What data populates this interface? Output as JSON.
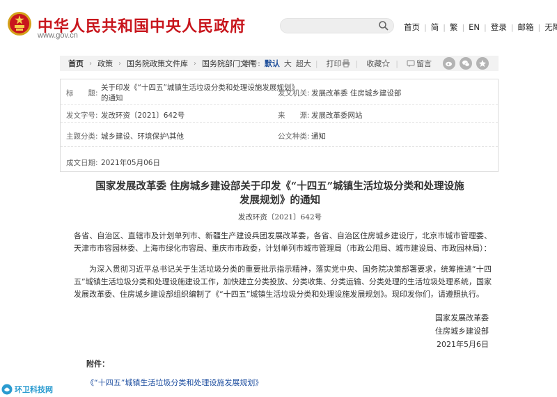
{
  "header": {
    "site_title": "中华人民共和国中央人民政府",
    "site_domain": "www.gov.cn",
    "search_placeholder": "",
    "links": [
      "首页",
      "简",
      "繁",
      "EN",
      "登录",
      "邮箱",
      "无障碍"
    ]
  },
  "breadcrumb": {
    "items": [
      "首页",
      "政策",
      "国务院政策文件库",
      "国务院部门文件"
    ]
  },
  "toolbar": {
    "font_label": "字号:",
    "font_default": "默认",
    "font_large": "大",
    "font_xlarge": "超大",
    "print": "打印",
    "favorite": "收藏",
    "comment": "留言"
  },
  "meta": {
    "title_label": "标　　题:",
    "title_value_1": "关于印发《“十四五”城镇生活垃圾分类和处理设施发展规划》",
    "title_value_2": "的通知",
    "issuer_label": "发文机关:",
    "issuer_value": "发展改革委  住房城乡建设部",
    "docnum_label": "发文字号:",
    "docnum_value": "发改环资〔2021〕642号",
    "source_label": "来　　源:",
    "source_value": "发展改革委网站",
    "category_label": "主题分类:",
    "category_value": "城乡建设、环境保护\\其他",
    "type_label": "公文种类:",
    "type_value": "通知",
    "date_label": "成文日期:",
    "date_value": "2021年05月06日"
  },
  "article": {
    "title_line1": "国家发展改革委  住房城乡建设部关于印发《“十四五”城镇生活垃圾分类和处理设施",
    "title_line2": "发展规划》的通知",
    "doc_number": "发改环资〔2021〕642号",
    "para1": "各省、自治区、直辖市及计划单列市、新疆生产建设兵团发展改革委，各省、自治区住房城乡建设厅，北京市城市管理委、天津市市容园林委、上海市绿化市容局、重庆市市政委，计划单列市城市管理局（市政公用局、城市建设局、市政园林局）：",
    "para2": "为深入贯彻习近平总书记关于生活垃圾分类的重要批示指示精神，落实党中央、国务院决策部署要求，统筹推进“十四五”城镇生活垃圾分类和处理设施建设工作，加快建立分类投放、分类收集、分类运输、分类处理的生活垃圾处理系统，国家发展改革委、住房城乡建设部组织编制了《“十四五”城镇生活垃圾分类和处理设施发展规划》。现印发你们，请遵照执行。",
    "sign1": "国家发展改革委",
    "sign2": "住房城乡建设部",
    "sign_date": "2021年5月6日",
    "attach_label": "附件：",
    "attach_link": "《“十四五”城镇生活垃圾分类和处理设施发展规划》"
  },
  "watermark": {
    "text": "环卫科技网"
  },
  "colors": {
    "brand_red": "#c8161d",
    "link_blue": "#1f4fa0"
  }
}
